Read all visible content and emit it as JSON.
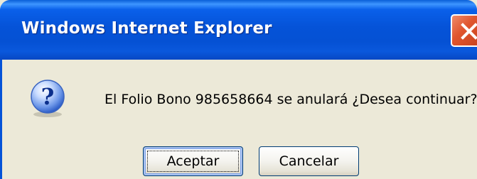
{
  "window": {
    "title": "Windows Internet Explorer"
  },
  "dialog": {
    "icon": "question-icon",
    "message": "El Folio Bono 985658664 se anulará ¿Desea continuar?"
  },
  "buttons": {
    "accept_label": "Aceptar",
    "cancel_label": "Cancelar"
  },
  "colors": {
    "titlebar": "#0553d8",
    "background": "#ece9d8",
    "close_button": "#e0552e"
  }
}
